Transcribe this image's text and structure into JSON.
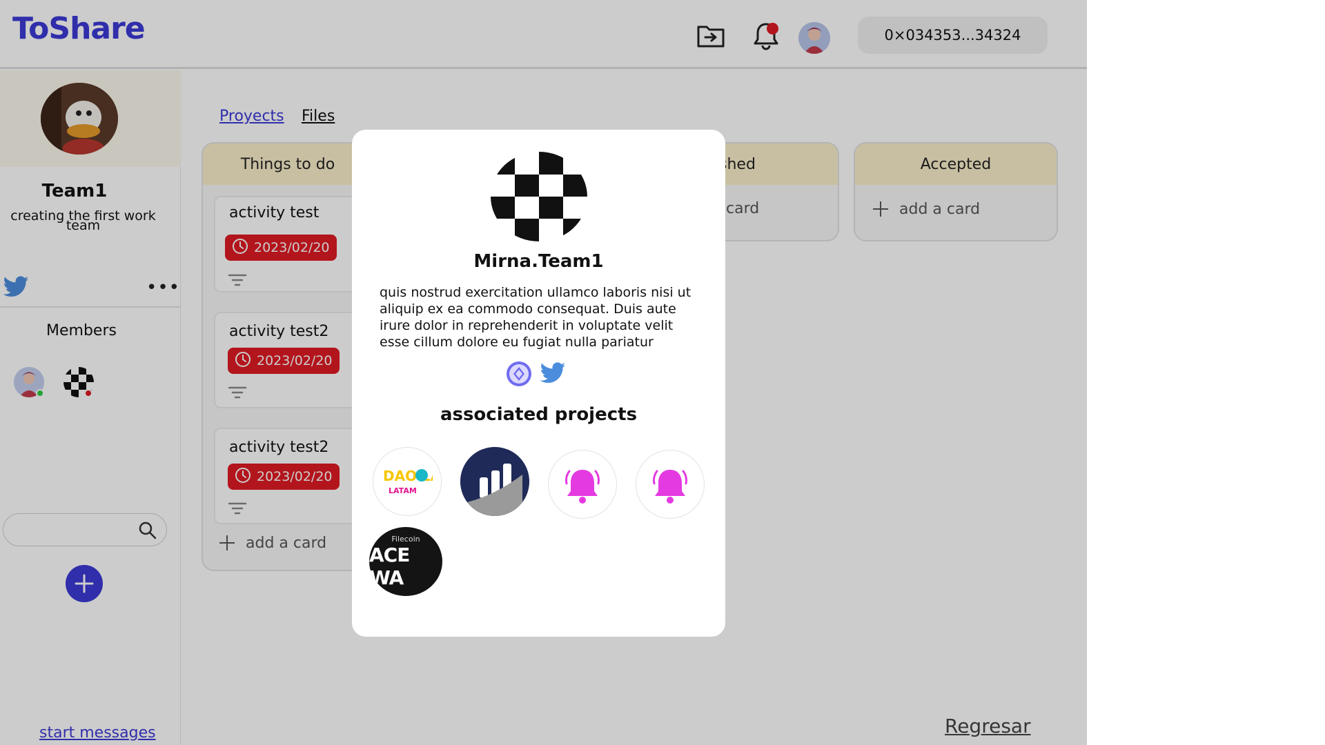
{
  "header": {
    "logo": "ToShare",
    "wallet_address": "0×034353...34324",
    "icons": [
      "folder-import-icon",
      "bell-icon",
      "user-avatar"
    ]
  },
  "sidebar": {
    "team_name": "Team1",
    "team_description": "creating the first work team",
    "members_title": "Members",
    "search_placeholder": "",
    "start_messages": "start messages"
  },
  "tabs": [
    {
      "label": "Proyects",
      "active": true
    },
    {
      "label": "Files",
      "active": false
    }
  ],
  "columns": {
    "todo": {
      "title": "Things to do",
      "cards": [
        {
          "title": "activity test",
          "date": "2023/02/20"
        },
        {
          "title": "activity test2",
          "date": "2023/02/20"
        },
        {
          "title": "activity test2",
          "date": "2023/02/20"
        }
      ],
      "add_label": "add a card"
    },
    "finished": {
      "title": "shed",
      "add_label": "card"
    },
    "accepted": {
      "title": "Accepted",
      "add_label": "add a card"
    }
  },
  "modal": {
    "name": "Mirna.Team1",
    "bio": "quis nostrud exercitation ullamco laboris nisi ut aliquip ex ea commodo consequat. Duis aute irure dolor in reprehenderit in voluptate velit esse cillum dolore eu fugiat nulla pariatur",
    "associated_title": "associated projects",
    "projects": [
      {
        "name": "dao-hackathon-latam-logo",
        "text": "DAO LATAM"
      },
      {
        "name": "bar-chart-logo"
      },
      {
        "name": "bell-logo"
      },
      {
        "name": "bell-logo"
      },
      {
        "name": "filecoin-space-warp-logo",
        "small": "Filecoin",
        "big": "ACE WA"
      }
    ]
  },
  "footer": {
    "back_label": "Regresar"
  },
  "colors": {
    "accent": "#3d3ad6",
    "date_badge": "#e01b24",
    "column_header": "#fbefcb"
  }
}
